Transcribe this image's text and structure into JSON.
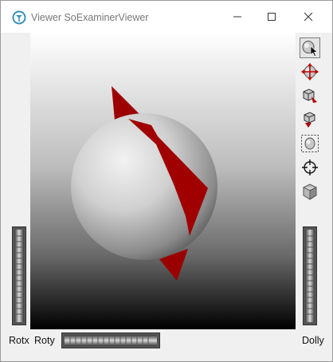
{
  "window": {
    "title": "Viewer SoExaminerViewer"
  },
  "title_controls": {
    "minimize_icon": "minimize-icon",
    "maximize_icon": "maximize-icon",
    "close_icon": "close-icon"
  },
  "toolbar": {
    "buttons": [
      {
        "icon": "pick-arrow-icon",
        "active": true
      },
      {
        "icon": "view-move-icon",
        "active": false
      },
      {
        "icon": "home-icon",
        "active": false
      },
      {
        "icon": "set-home-icon",
        "active": false
      },
      {
        "icon": "view-all-icon",
        "active": false
      },
      {
        "icon": "seek-icon",
        "active": false
      },
      {
        "icon": "projection-cube-icon",
        "active": false
      }
    ]
  },
  "wheels": {
    "rotx_label": "Rotx",
    "roty_label": "Roty",
    "dolly_label": "Dolly"
  },
  "colors": {
    "shape_red": "#a00000",
    "sphere_gray": "#c8c8c8"
  }
}
